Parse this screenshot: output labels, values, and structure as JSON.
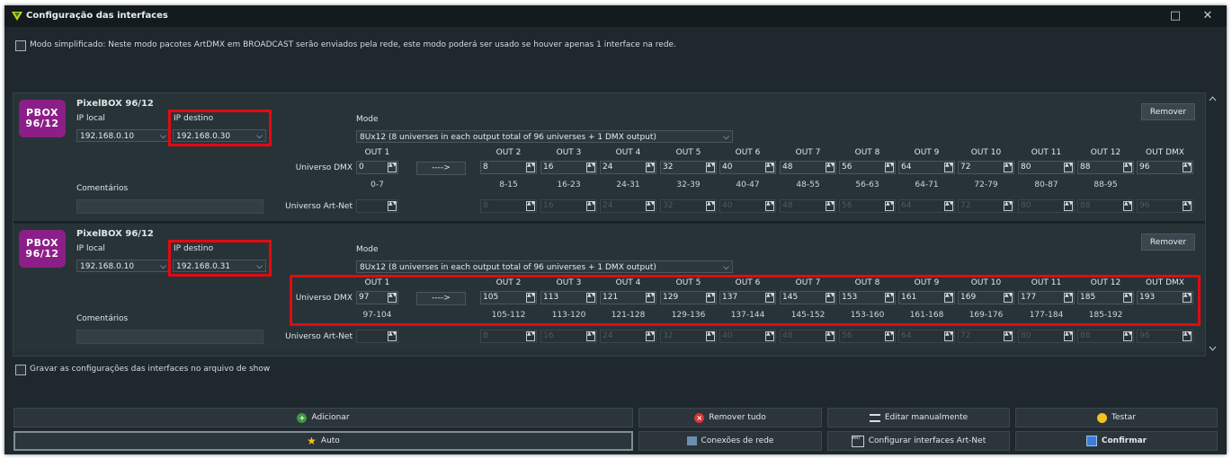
{
  "window": {
    "title": "Configuração das interfaces",
    "maximize": "□",
    "close": "✕"
  },
  "simplified_mode": {
    "label": "Modo simplificado: Neste modo pacotes ArtDMX em BROADCAST serão enviados pela rede, este modo poderá ser usado se houver apenas 1 interface na rede."
  },
  "labels": {
    "ip_local": "IP local",
    "ip_destino": "IP destino",
    "mode": "Mode",
    "comentarios": "Comentários",
    "universo_dmx": "Universo DMX",
    "universo_artnet": "Universo Art-Net",
    "remover": "Remover",
    "arrow": "---->"
  },
  "outputs": [
    "OUT 1",
    "OUT 2",
    "OUT 3",
    "OUT 4",
    "OUT 5",
    "OUT 6",
    "OUT 7",
    "OUT 8",
    "OUT 9",
    "OUT 10",
    "OUT 11",
    "OUT 12",
    "OUT DMX"
  ],
  "interfaces": [
    {
      "name": "PixelBOX 96/12",
      "logo_line1": "PBOX",
      "logo_line2": "96/12",
      "ip_local": "192.168.0.10",
      "ip_destino": "192.168.0.30",
      "mode": "8Ux12 (8 universes in each output total of 96 universes + 1 DMX output)",
      "dmx": [
        "0",
        "8",
        "16",
        "24",
        "32",
        "40",
        "48",
        "56",
        "64",
        "72",
        "80",
        "88",
        "96"
      ],
      "ranges": [
        "0-7",
        "8-15",
        "16-23",
        "24-31",
        "32-39",
        "40-47",
        "48-55",
        "56-63",
        "64-71",
        "72-79",
        "80-87",
        "88-95"
      ],
      "artnet": [
        "",
        "8",
        "16",
        "24",
        "32",
        "40",
        "48",
        "56",
        "64",
        "72",
        "80",
        "88",
        "96"
      ]
    },
    {
      "name": "PixelBOX 96/12",
      "logo_line1": "PBOX",
      "logo_line2": "96/12",
      "ip_local": "192.168.0.10",
      "ip_destino": "192.168.0.31",
      "mode": "8Ux12 (8 universes in each output total of 96 universes + 1 DMX output)",
      "dmx": [
        "97",
        "105",
        "113",
        "121",
        "129",
        "137",
        "145",
        "153",
        "161",
        "169",
        "177",
        "185",
        "193"
      ],
      "ranges": [
        "97-104",
        "105-112",
        "113-120",
        "121-128",
        "129-136",
        "137-144",
        "145-152",
        "153-160",
        "161-168",
        "169-176",
        "177-184",
        "185-192"
      ],
      "artnet": [
        "",
        "8",
        "16",
        "24",
        "32",
        "40",
        "48",
        "56",
        "64",
        "72",
        "80",
        "88",
        "96"
      ]
    }
  ],
  "save_config": {
    "label": "Gravar as configurações das interfaces no arquivo de show"
  },
  "buttons": {
    "adicionar": "Adicionar",
    "remover_tudo": "Remover tudo",
    "editar_manualmente": "Editar manualmente",
    "testar": "Testar",
    "auto": "Auto",
    "conexoes": "Conexões de rede",
    "configurar": "Configurar interfaces Art-Net",
    "confirmar": "Confirmar"
  },
  "colors": {
    "highlight": "#e30a10",
    "logo": "#8b1f87",
    "background": "#1e282e"
  }
}
